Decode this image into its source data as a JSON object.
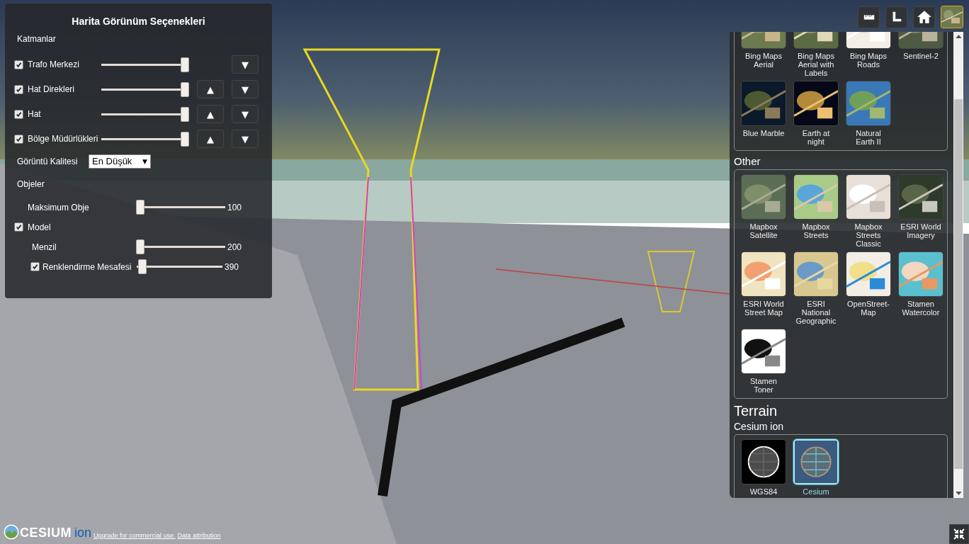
{
  "options_panel": {
    "title": "Harita Görünüm Seçenekleri",
    "layers_heading": "Katmanlar",
    "layers": [
      {
        "name": "Trafo Merkezi",
        "checked": true,
        "level": 1,
        "down": "▼"
      },
      {
        "name": "Hat Direkleri",
        "checked": true,
        "level": 1,
        "up": "▲",
        "down": "▼"
      },
      {
        "name": "Hat",
        "checked": true,
        "level": 1,
        "up": "▲",
        "down": "▼"
      },
      {
        "name": "Bölge Müdürlükleri",
        "checked": true,
        "level": 1,
        "up": "▲",
        "down": "▼"
      }
    ],
    "quality": {
      "label": "Görüntü Kalitesi",
      "value": "En Düşük",
      "caret": "▼"
    },
    "objects_heading": "Objeler",
    "objects": [
      {
        "kind": "slider",
        "label": "Maksimum Obje",
        "level": 0,
        "reading": "100"
      },
      {
        "kind": "checkbox",
        "label": "Model",
        "checked": true
      },
      {
        "kind": "slider",
        "label": "Menzil",
        "level": 0,
        "reading": "200"
      },
      {
        "kind": "checkbox_slider",
        "label": "Renklendirme Mesafesi",
        "checked": true,
        "level": 0.02,
        "reading": "390"
      }
    ]
  },
  "base_layer_picker": {
    "groups": [
      {
        "items": [
          {
            "label": "Bing Maps Aerial",
            "selected": false
          },
          {
            "label": "Bing Maps Aerial with Labels",
            "selected": false
          },
          {
            "label": "Bing Maps Roads",
            "selected": false
          },
          {
            "label": "Sentinel-2",
            "selected": false
          },
          {
            "label": "Blue Marble",
            "selected": false
          },
          {
            "label": "Earth at night",
            "selected": false
          },
          {
            "label": "Natural Earth II",
            "selected": false
          }
        ]
      },
      {
        "heading": "Other",
        "items": [
          {
            "label": "Mapbox Satellite",
            "selected": false
          },
          {
            "label": "Mapbox Streets",
            "selected": false
          },
          {
            "label": "Mapbox Streets Classic",
            "selected": false
          },
          {
            "label": "ESRI World Imagery",
            "selected": false
          },
          {
            "label": "ESRI World Street Map",
            "selected": false
          },
          {
            "label": "ESRI National Geographic",
            "selected": false
          },
          {
            "label": "OpenStreet-Map",
            "selected": false
          },
          {
            "label": "Stamen Watercolor",
            "selected": false
          },
          {
            "label": "Stamen Toner",
            "selected": false
          }
        ]
      }
    ],
    "terrain": {
      "heading": "Terrain",
      "groups": [
        {
          "heading": "Cesium ion",
          "items": [
            {
              "label": "WGS84",
              "selected": false
            },
            {
              "label": "Cesium",
              "selected": true
            }
          ]
        }
      ]
    }
  },
  "footer": {
    "logo_text": "CESIUM",
    "logo_suffix": "ion",
    "links": [
      "Upgrade for commercial use.",
      "Data attribution"
    ]
  }
}
